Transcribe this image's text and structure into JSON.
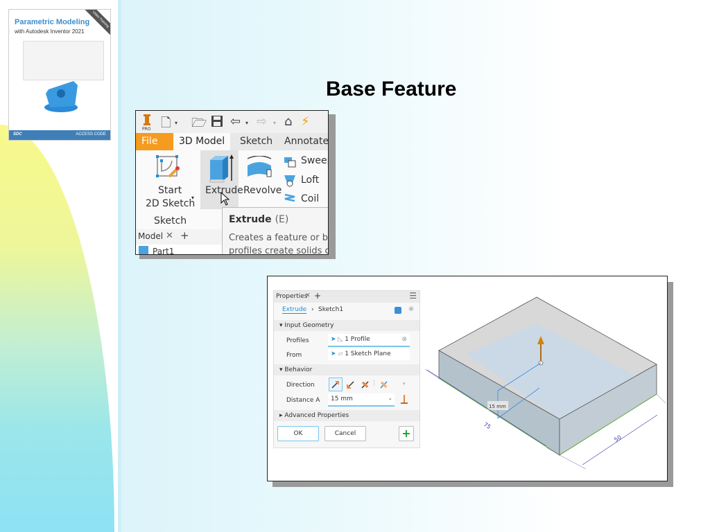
{
  "slide": {
    "title": "Base Feature",
    "book_cover": {
      "title": "Parametric Modeling",
      "subtitle": "with Autodesk Inventor 2021",
      "badge": "Video Training",
      "publisher": "SDC",
      "footer_right": "ACCESS CODE"
    }
  },
  "inventor_ribbon": {
    "app_badge": "PRO",
    "tabs": [
      {
        "label": "File"
      },
      {
        "label": "3D Model"
      },
      {
        "label": "Sketch"
      },
      {
        "label": "Annotate"
      }
    ],
    "tools": {
      "start_sketch_line1": "Start",
      "start_sketch_line2": "2D Sketch",
      "extrude": "Extrude",
      "revolve": "Revolve",
      "sweep": "Sweep",
      "loft": "Loft",
      "coil": "Coil"
    },
    "panel_label": "Sketch",
    "browser_tab": "Model",
    "browser_item": "Part1",
    "tooltip": {
      "title": "Extrude",
      "shortcut": "(E)",
      "line1": "Creates a feature or bo",
      "line2": "profiles create solids o"
    }
  },
  "properties_panel": {
    "tab_label": "Properties",
    "breadcrumb": {
      "feature": "Extrude",
      "sketch": "Sketch1"
    },
    "sections": {
      "input_geometry": "Input Geometry",
      "behavior": "Behavior",
      "advanced": "Advanced Properties"
    },
    "fields": {
      "profiles_label": "Profiles",
      "profiles_value": "1 Profile",
      "from_label": "From",
      "from_value": "1 Sketch Plane",
      "direction_label": "Direction",
      "distance_label": "Distance A",
      "distance_value": "15 mm"
    },
    "buttons": {
      "ok": "OK",
      "cancel": "Cancel",
      "add": "+"
    }
  },
  "viewport": {
    "dim_length": "75",
    "dim_width": "50",
    "dim_height": "15 mm"
  },
  "colors": {
    "file_tab": "#f59b1e",
    "accent_blue": "#1a8fd6",
    "dimension": "#3a3aa8",
    "extrude_arrow": "#d4820e"
  }
}
